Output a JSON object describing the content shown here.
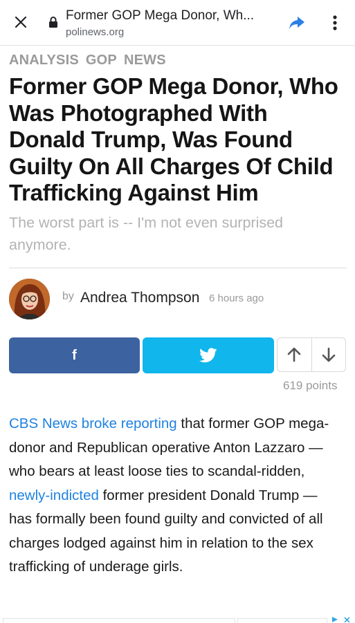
{
  "browser": {
    "page_title": "Former GOP Mega Donor, Wh...",
    "url": "polinews.org"
  },
  "article": {
    "tags": [
      "ANALYSIS",
      "GOP",
      "NEWS"
    ],
    "headline": "Former GOP Mega Donor, Who Was Photographed With Donald Trump, Was Found Guilty On All Charges Of Child Trafficking Against Him",
    "subheadline": "The worst part is -- I'm not even surprised anymore.",
    "byline_prefix": "by",
    "author": "Andrea Thompson",
    "published": "6 hours ago",
    "share": {
      "facebook_label": "f"
    },
    "points": "619 points",
    "body": {
      "link1": "CBS News broke reporting",
      "text1": " that former GOP mega-donor and Republican operative Anton Lazzaro — who bears at least loose ties to scandal-ridden, ",
      "link2": "newly-indicted",
      "text2": " former president Donald Trump — has formally been found guilty and convicted of all charges lodged against him in relation to the sex trafficking of underage girls."
    }
  },
  "colors": {
    "facebook": "#3d62a0",
    "twitter": "#10b6ec",
    "link": "#1f82e0",
    "share_arrow": "#2d7fe6"
  },
  "icons": [
    "close-icon",
    "lock-icon",
    "share-icon",
    "more-vert-icon",
    "facebook-icon",
    "twitter-icon",
    "arrow-up-icon",
    "arrow-down-icon"
  ]
}
